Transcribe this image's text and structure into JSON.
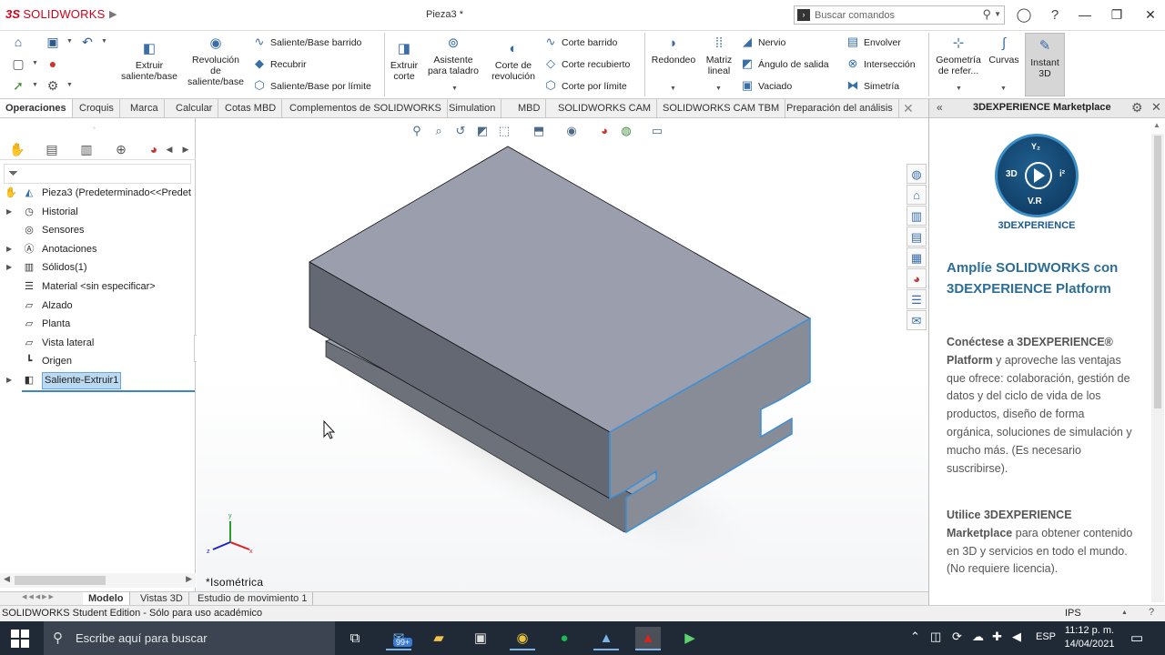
{
  "app": {
    "brand_prefix": "3S",
    "brand_name": "SOLIDWORKS",
    "document_title": "Pieza3 *"
  },
  "search": {
    "placeholder": "Buscar comandos"
  },
  "quick_access": {
    "home": "home-icon",
    "new": "new-document-icon",
    "save": "save-icon",
    "undo": "undo-icon",
    "select": "select-icon",
    "rebuild": "rebuild-icon",
    "options": "options-icon"
  },
  "commands": {
    "extrude_boss": "Extruir saliente/base",
    "revolve_boss": "Revolución de saliente/base",
    "swept_boss": "Saliente/Base barrido",
    "loft_boss": "Recubrir",
    "boundary_boss": "Saliente/Base por límite",
    "extrude_cut": "Extruir corte",
    "hole_wizard": "Asistente para taladro",
    "revolve_cut": "Corte de revolución",
    "swept_cut": "Corte barrido",
    "lofted_cut": "Corte recubierto",
    "boundary_cut": "Corte por límite",
    "fillet": "Redondeo",
    "linear_pattern": "Matriz lineal",
    "rib": "Nervio",
    "draft": "Ángulo de salida",
    "shell": "Vaciado",
    "wrap": "Envolver",
    "intersect": "Intersección",
    "mirror": "Simetría",
    "ref_geometry": "Geometría de refer...",
    "curves": "Curvas",
    "instant3d": "Instant 3D"
  },
  "tabs": [
    "Operaciones",
    "Croquis",
    "Marca",
    "Calcular",
    "Cotas MBD",
    "Complementos de SOLIDWORKS",
    "Simulation",
    "MBD",
    "SOLIDWORKS CAM",
    "SOLIDWORKS CAM TBM",
    "Preparación del análisis"
  ],
  "feature_tree": {
    "root": "Pieza3  (Predeterminado<<Predet",
    "items": [
      {
        "label": "Historial",
        "expandable": true
      },
      {
        "label": "Sensores",
        "expandable": false
      },
      {
        "label": "Anotaciones",
        "expandable": true
      },
      {
        "label": "Sólidos(1)",
        "expandable": true
      },
      {
        "label": "Material <sin especificar>",
        "expandable": false
      },
      {
        "label": "Alzado",
        "expandable": false
      },
      {
        "label": "Planta",
        "expandable": false
      },
      {
        "label": "Vista lateral",
        "expandable": false
      },
      {
        "label": "Origen",
        "expandable": false
      },
      {
        "label": "Saliente-Extruir1",
        "expandable": true,
        "selected": true
      }
    ]
  },
  "viewport": {
    "view_name": "*Isométrica",
    "triad_x": "x",
    "triad_y": "y",
    "triad_z": "z"
  },
  "bottom_tabs": [
    "Modelo",
    "Vistas 3D",
    "Estudio de movimiento 1"
  ],
  "taskpane": {
    "title": "3DEXPERIENCE Marketplace",
    "logo_text": {
      "yz": "Y₂",
      "l3d": "3D",
      "li": "i²",
      "vr": "V.R"
    },
    "brand": "3DEXPERIENCE",
    "heading": "Amplíe SOLIDWORKS con 3DEXPERIENCE Platform",
    "p1_bold": "Conéctese a 3DEXPERIENCE® Platform",
    "p1_rest": " y aproveche las ventajas que ofrece: colaboración, gestión de datos y del ciclo de vida de los productos, diseño de forma orgánica, soluciones de simulación y mucho más. (Es necesario suscribirse).",
    "p2_bold": "Utilice 3DEXPERIENCE Marketplace",
    "p2_rest": " para obtener contenido en 3D y servicios en todo el mundo. (No requiere licencia)."
  },
  "status": {
    "text": "SOLIDWORKS Student Edition - Sólo para uso académico",
    "units": "IPS"
  },
  "taskbar": {
    "search_placeholder": "Escribe aquí para buscar",
    "mail_badge": "99+",
    "language": "ESP",
    "time": "11:12 p. m.",
    "date": "14/04/2021"
  }
}
